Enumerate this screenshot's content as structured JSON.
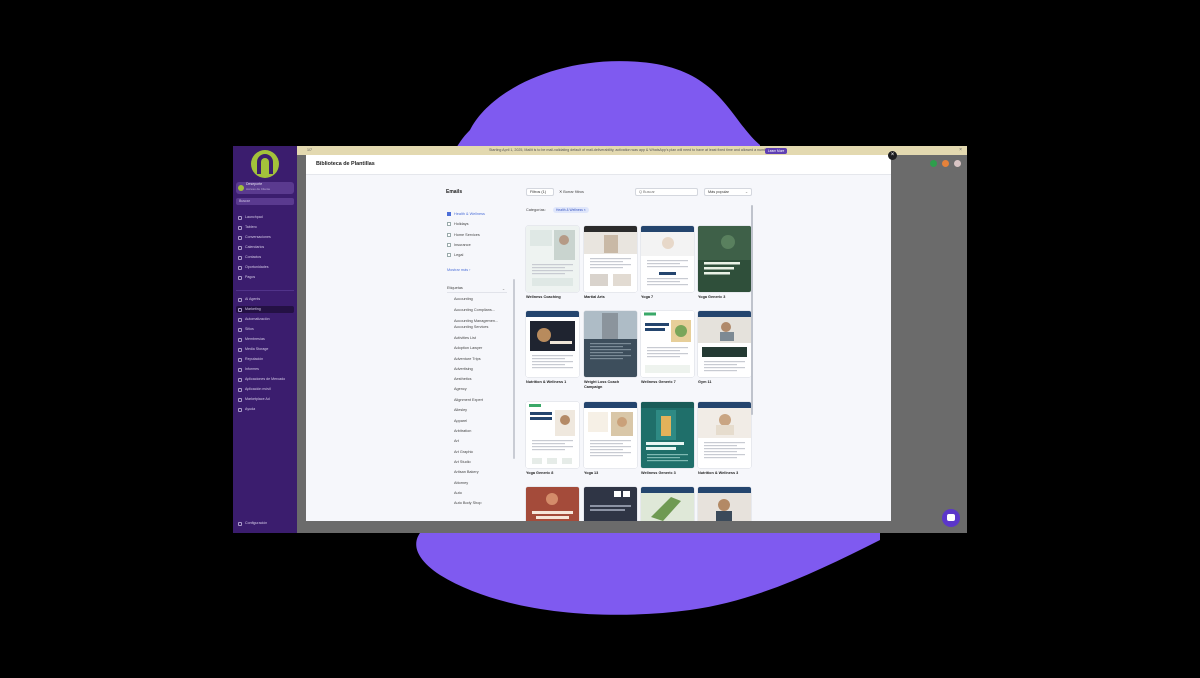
{
  "sidebar": {
    "account_name": "Deseporte",
    "account_sub": "Acceso de Cliente",
    "search_placeholder": "Buscar",
    "items": [
      {
        "label": "Launchpad"
      },
      {
        "label": "Tablero"
      },
      {
        "label": "Conversaciones"
      },
      {
        "label": "Calendarios"
      },
      {
        "label": "Contactos"
      },
      {
        "label": "Oportunidades"
      },
      {
        "label": "Pagos"
      },
      {
        "label": "Ai Agents"
      },
      {
        "label": "Marketing"
      },
      {
        "label": "Automatización"
      },
      {
        "label": "Sitios"
      },
      {
        "label": "Membresías"
      },
      {
        "label": "Media Storage"
      },
      {
        "label": "Reputación"
      },
      {
        "label": "Informes"
      },
      {
        "label": "Aplicaciones de Mercado"
      },
      {
        "label": "Aplicación móvil"
      },
      {
        "label": "Marketplace Ad"
      },
      {
        "label": "Ayuda"
      }
    ],
    "settings_label": "Configuración"
  },
  "topbar": {
    "left": "1/7",
    "text": "Starting April 1, 2025, Mailit is to be mail-validating default of mail-deliverability, activation was app & WhatsApp's plan will need to have at least fixed time and allowed a number.",
    "learn_more": "Learn More"
  },
  "modal": {
    "title": "Biblioteca de Plantillas",
    "close": "×"
  },
  "categories": {
    "title": "Emails",
    "items": [
      {
        "label": "Health & Wellness",
        "selected": true
      },
      {
        "label": "Holidays",
        "selected": false
      },
      {
        "label": "Home Services",
        "selected": false
      },
      {
        "label": "Insurance",
        "selected": false
      },
      {
        "label": "Legal",
        "selected": false
      }
    ],
    "show_more": "Mostrar más ›",
    "subcategory_label": "Etiquetas",
    "subcategory_chevron": "⌄",
    "subcategories": [
      "Accounting",
      "Accounting Complians...",
      "Accounting Managemen...",
      "Accounting Services",
      "Activities List",
      "Adoption Lawyer",
      "Adventure Trips",
      "Advertising",
      "Aesthetics",
      "Agency",
      "Alignment Expert",
      "Allesley",
      "Apparel",
      "Arbitration",
      "Art",
      "Art Graphic",
      "Art Studio",
      "Artisan Bakery",
      "Attorney",
      "Auto",
      "Auto Body Shop"
    ]
  },
  "toolbar": {
    "filter_label": "Filtros",
    "filter_count": "(1)",
    "clear_label": "✕ Borrar filtros",
    "search_placeholder": "Q Buscar",
    "sort_label": "Más popular",
    "sort_chevron": "⌄",
    "category_label": "Categorías:",
    "chip_label": "Health & Wellness ×"
  },
  "templates": [
    {
      "name": "Wellness Coaching",
      "name2": "",
      "art": "wellness-coaching"
    },
    {
      "name": "Martial Arts",
      "name2": "",
      "art": "martial-arts"
    },
    {
      "name": "Yoga 7",
      "name2": "",
      "art": "yoga-7"
    },
    {
      "name": "Yoga Generic 3",
      "name2": "",
      "art": "yoga-generic-3"
    },
    {
      "name": "Nutrition & Wellness 1",
      "name2": "",
      "art": "nutrition-1"
    },
    {
      "name": "Weight Loss Coach",
      "name2": "Campaign",
      "art": "weight-loss"
    },
    {
      "name": "Wellness Generic 7",
      "name2": "",
      "art": "wellness-generic-7"
    },
    {
      "name": "Gym 11",
      "name2": "",
      "art": "gym-11"
    },
    {
      "name": "Yoga Generic 8",
      "name2": "",
      "art": "yoga-generic-8"
    },
    {
      "name": "Yoga 13",
      "name2": "",
      "art": "yoga-13"
    },
    {
      "name": "Wellness Generic 3",
      "name2": "",
      "art": "wellness-generic-3"
    },
    {
      "name": "Nutrition & Wellness 3",
      "name2": "",
      "art": "nutrition-3"
    },
    {
      "name": "",
      "name2": "",
      "art": "row4-a"
    },
    {
      "name": "",
      "name2": "",
      "art": "row4-b"
    },
    {
      "name": "",
      "name2": "",
      "art": "row4-c"
    },
    {
      "name": "",
      "name2": "",
      "art": "row4-d"
    }
  ],
  "thumb_text": {
    "yoga-generic-3": "Your new yoga routine starts now",
    "nutrition-1": "FIND YOUR BALANCE",
    "wellness-coaching": "Everyone, Anywhere Wellness",
    "wellness-generic-3": "Your Balanced Wellness Routine",
    "row4-a": "YOUR INNER"
  },
  "colors": {
    "brand_purple": "#7f5af0",
    "sidebar_bg": "#3b1d6e",
    "accent_blue": "#4c6fd8",
    "header_navy": "#24456e"
  },
  "icons": {
    "chat": "chat-icon",
    "close": "close-icon",
    "search": "search-icon"
  }
}
